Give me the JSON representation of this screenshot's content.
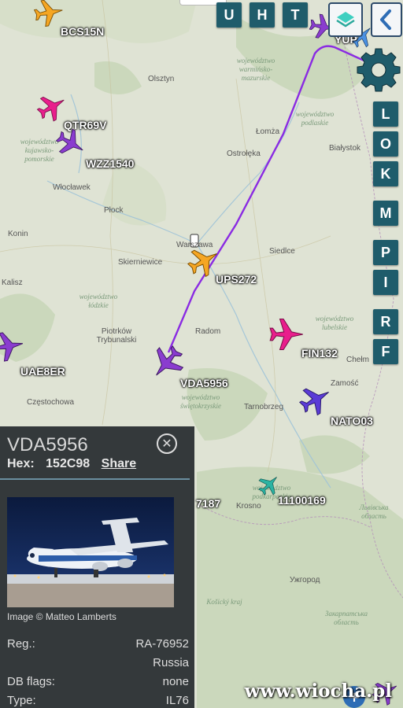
{
  "top_buttons": [
    "U",
    "H",
    "T"
  ],
  "right_buttons": [
    "L",
    "O",
    "K",
    "M",
    "P",
    "I",
    "R",
    "F"
  ],
  "icons": {
    "layers": "layers-icon",
    "back": "chevron-left-icon",
    "settings": "gear-icon",
    "close": "close-circle-icon",
    "location": "location-icon"
  },
  "aircraft": [
    {
      "callsign": "BCS15N",
      "color": "#f5a623"
    },
    {
      "callsign": "QTR69V",
      "color": "#e91e8c"
    },
    {
      "callsign": "WZZ1540",
      "color": "#8a3ccf"
    },
    {
      "callsign": "UPS272",
      "color": "#f5a623"
    },
    {
      "callsign": "UAE8ER",
      "color": "#8a3ccf"
    },
    {
      "callsign": "FIN132",
      "color": "#e91e8c"
    },
    {
      "callsign": "VDA5956",
      "color": "#8a3ccf"
    },
    {
      "callsign": "NATO03",
      "color": "#5a3bd6"
    },
    {
      "callsign": "11100169",
      "color": "#2bb3a3"
    },
    {
      "callsign": "YUP",
      "color": "#8a3ccf"
    },
    {
      "callsign": "7187",
      "color": "#8a3ccf"
    }
  ],
  "cities": [
    "Olsztyn",
    "Ostrołęka",
    "Łomża",
    "Białystok",
    "Włocławek",
    "Płock",
    "Konin",
    "Skierniewice",
    "Warszawa",
    "Siedlce",
    "Kalisz",
    "Piotrków Trybunalski",
    "Radom",
    "Częstochowa",
    "Tarnobrzeg",
    "Zamość",
    "Chełm",
    "Krosno",
    "Ужгород"
  ],
  "regions": [
    "województwo warmińsko-mazurskie",
    "województwo podlaskie",
    "województwo kujawsko-pomorskie",
    "województwo łódzkie",
    "województwo świętokrzyskie",
    "województwo lubelskie",
    "województwo podkarpackie",
    "Košický kraj",
    "Закарпатська область",
    "Львівська область"
  ],
  "panel": {
    "callsign": "VDA5956",
    "hex_label": "Hex:",
    "hex_value": "152C98",
    "share_label": "Share",
    "photo_credit": "Image © Matteo Lamberts",
    "rows": [
      {
        "label": "Reg.:",
        "value": "RA-76952"
      },
      {
        "label": "",
        "value": "Russia"
      },
      {
        "label": "DB flags:",
        "value": "none"
      },
      {
        "label": "Type:",
        "value": "IL76"
      }
    ]
  },
  "watermark": "www.wiocha.pl"
}
